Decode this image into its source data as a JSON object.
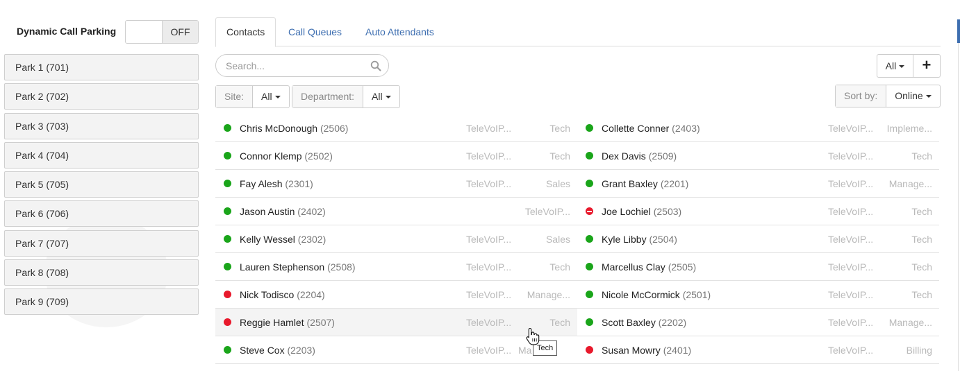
{
  "park_panel": {
    "title": "Dynamic Call Parking",
    "toggle_state": "OFF",
    "parks": [
      {
        "label": "Park 1 (701)"
      },
      {
        "label": "Park 2 (702)"
      },
      {
        "label": "Park 3 (703)"
      },
      {
        "label": "Park 4 (704)"
      },
      {
        "label": "Park 5 (705)"
      },
      {
        "label": "Park 6 (706)"
      },
      {
        "label": "Park 7 (707)"
      },
      {
        "label": "Park 8 (708)"
      },
      {
        "label": "Park 9 (709)"
      }
    ]
  },
  "tabs": [
    {
      "label": "Contacts",
      "active": true
    },
    {
      "label": "Call Queues",
      "active": false
    },
    {
      "label": "Auto Attendants",
      "active": false
    }
  ],
  "search": {
    "placeholder": "Search...",
    "value": ""
  },
  "filters": {
    "site_label": "Site:",
    "site_value": "All",
    "department_label": "Department:",
    "department_value": "All",
    "sort_label": "Sort by:",
    "sort_value": "Online",
    "view_value": "All",
    "add_label": "+"
  },
  "colors": {
    "online": "#1aa51a",
    "offline": "#e8192c",
    "dnd": "#e8192c",
    "link": "#3d6eb0"
  },
  "contacts": [
    {
      "left": {
        "name": "Chris McDonough",
        "ext": "(2506)",
        "site": "TeleVoIP...",
        "dept": "Tech",
        "status": "online"
      },
      "right": {
        "name": "Collette Conner",
        "ext": "(2403)",
        "site": "TeleVoIP...",
        "dept": "Impleme...",
        "status": "online"
      }
    },
    {
      "left": {
        "name": "Connor Klemp",
        "ext": "(2502)",
        "site": "TeleVoIP...",
        "dept": "Tech",
        "status": "online"
      },
      "right": {
        "name": "Dex Davis",
        "ext": "(2509)",
        "site": "TeleVoIP...",
        "dept": "Tech",
        "status": "online"
      }
    },
    {
      "left": {
        "name": "Fay Alesh",
        "ext": "(2301)",
        "site": "TeleVoIP...",
        "dept": "Sales",
        "status": "online"
      },
      "right": {
        "name": "Grant Baxley",
        "ext": "(2201)",
        "site": "TeleVoIP...",
        "dept": "Manage...",
        "status": "online"
      }
    },
    {
      "left": {
        "name": "Jason Austin",
        "ext": "(2402)",
        "site": "",
        "dept": "TeleVoIP...",
        "status": "online"
      },
      "right": {
        "name": "Joe Lochiel",
        "ext": "(2503)",
        "site": "TeleVoIP...",
        "dept": "Tech",
        "status": "dnd"
      }
    },
    {
      "left": {
        "name": "Kelly Wessel",
        "ext": "(2302)",
        "site": "TeleVoIP...",
        "dept": "Sales",
        "status": "online"
      },
      "right": {
        "name": "Kyle Libby",
        "ext": "(2504)",
        "site": "TeleVoIP...",
        "dept": "Tech",
        "status": "online"
      }
    },
    {
      "left": {
        "name": "Lauren Stephenson",
        "ext": "(2508)",
        "site": "TeleVoIP...",
        "dept": "Tech",
        "status": "online"
      },
      "right": {
        "name": "Marcellus Clay",
        "ext": "(2505)",
        "site": "TeleVoIP...",
        "dept": "Tech",
        "status": "online"
      }
    },
    {
      "left": {
        "name": "Nick Todisco",
        "ext": "(2204)",
        "site": "TeleVoIP...",
        "dept": "Manage...",
        "status": "offline"
      },
      "right": {
        "name": "Nicole McCormick",
        "ext": "(2501)",
        "site": "TeleVoIP...",
        "dept": "Tech",
        "status": "online"
      }
    },
    {
      "left": {
        "name": "Reggie Hamlet",
        "ext": "(2507)",
        "site": "TeleVoIP...",
        "dept": "Tech",
        "status": "offline"
      },
      "right": {
        "name": "Scott Baxley",
        "ext": "(2202)",
        "site": "TeleVoIP...",
        "dept": "Manage...",
        "status": "online"
      }
    },
    {
      "left": {
        "name": "Steve Cox",
        "ext": "(2203)",
        "site": "TeleVoIP...",
        "dept": "Ma",
        "status": "online"
      },
      "right": {
        "name": "Susan Mowry",
        "ext": "(2401)",
        "site": "TeleVoIP...",
        "dept": "Billing",
        "status": "offline"
      }
    }
  ],
  "tooltip": {
    "text": "Tech"
  },
  "icons": {
    "search": "search-icon",
    "add": "plus-icon",
    "cursor": "hand-cursor-icon"
  }
}
